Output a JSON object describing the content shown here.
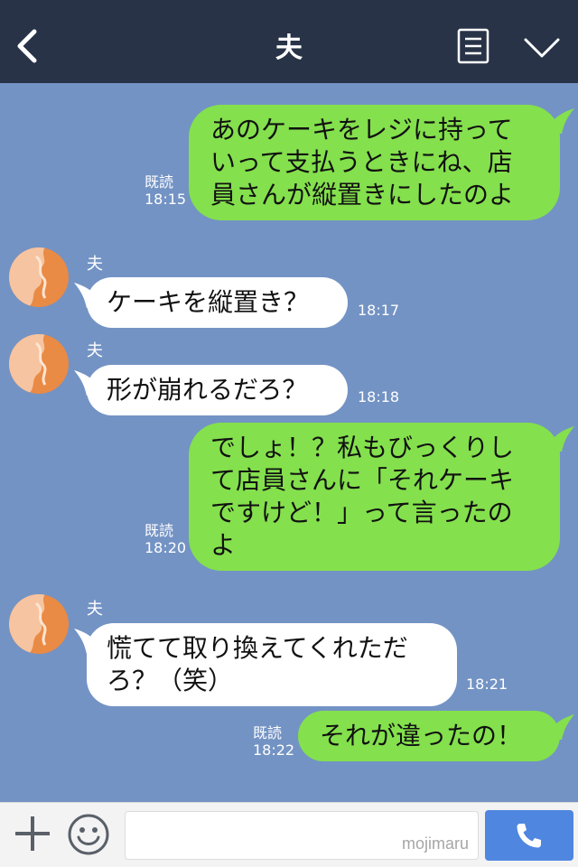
{
  "header": {
    "title": "夫",
    "back_icon": "chevron-left-icon",
    "menu_icon": "note-icon",
    "expand_icon": "chevron-down-icon",
    "background": "#283347"
  },
  "chat": {
    "background": "#7393c4",
    "outgoing_color": "#84e04d",
    "incoming_color": "#ffffff",
    "messages": [
      {
        "direction": "out",
        "lines": [
          "あのケーキをレジに持って",
          "いって支払うときにね、店",
          "員さんが縦置きにしたのよ"
        ],
        "read": "既読",
        "time": "18:15"
      },
      {
        "direction": "in",
        "sender": "夫",
        "lines": [
          "ケーキを縦置き？"
        ],
        "time": "18:17"
      },
      {
        "direction": "in",
        "sender": "夫",
        "lines": [
          "形が崩れるだろ？"
        ],
        "time": "18:18"
      },
      {
        "direction": "out",
        "lines": [
          "でしょ！？私もびっくりし",
          "て店員さんに「それケーキ",
          "ですけど！」って言ったの",
          "よ"
        ],
        "read": "既読",
        "time": "18:20"
      },
      {
        "direction": "in",
        "sender": "夫",
        "lines": [
          "慌てて取り換えてくれただ",
          "ろ？（笑）"
        ],
        "time": "18:21"
      },
      {
        "direction": "out",
        "lines": [
          "それが違ったの！"
        ],
        "read": "既読",
        "time": "18:22"
      }
    ]
  },
  "footer": {
    "plus_icon": "plus-icon",
    "sticker_icon": "smiley-icon",
    "input_value": "",
    "watermark": "mojimaru",
    "call_icon": "phone-icon",
    "call_color": "#4f86e0"
  }
}
